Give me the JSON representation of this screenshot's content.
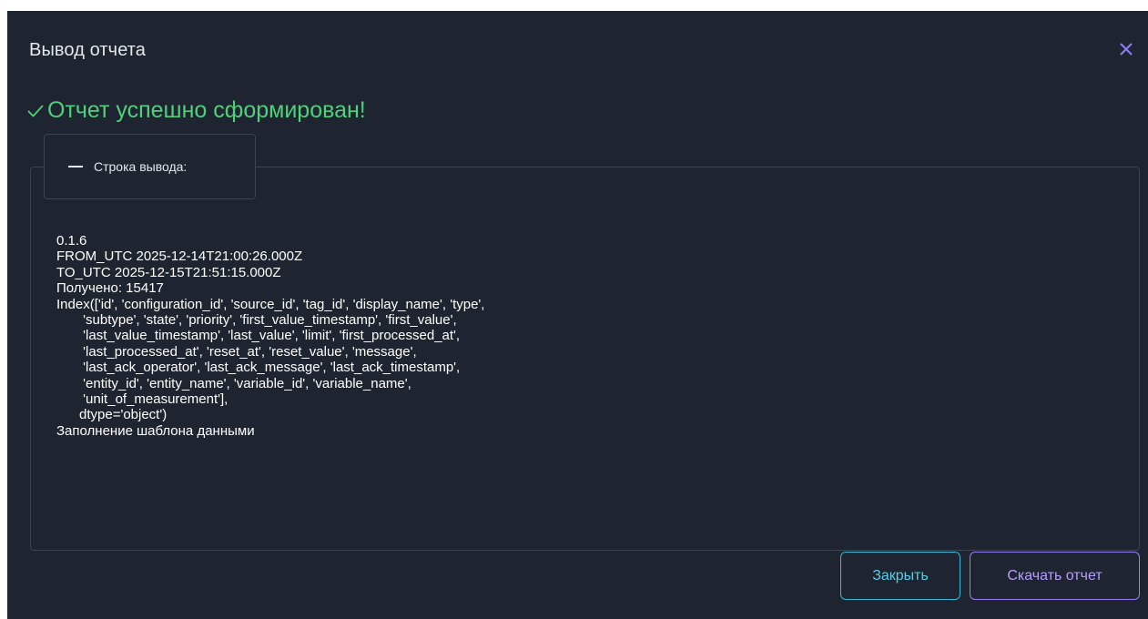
{
  "dialog": {
    "title": "Вывод отчета",
    "close_icon": "close-icon"
  },
  "status": {
    "icon": "check-icon",
    "message": "Отчет успешно сформирован!",
    "color": "#4fd07a"
  },
  "output_section": {
    "toggle_icon": "collapse-dash-icon",
    "label": "Строка вывода:",
    "lines": [
      "0.1.6",
      "FROM_UTC 2025-12-14T21:00:26.000Z",
      "TO_UTC 2025-12-15T21:51:15.000Z",
      "Получено: 15417",
      "Index(['id', 'configuration_id', 'source_id', 'tag_id', 'display_name', 'type',",
      "       'subtype', 'state', 'priority', 'first_value_timestamp', 'first_value',",
      "       'last_value_timestamp', 'last_value', 'limit', 'first_processed_at',",
      "       'last_processed_at', 'reset_at', 'reset_value', 'message',",
      "       'last_ack_operator', 'last_ack_message', 'last_ack_timestamp',",
      "       'entity_id', 'entity_name', 'variable_id', 'variable_name',",
      "       'unit_of_measurement'],",
      "      dtype='object')",
      "Заполнение шаблона данными"
    ]
  },
  "buttons": {
    "close_label": "Закрыть",
    "download_label": "Скачать отчет"
  },
  "colors": {
    "background": "#1f2530",
    "close_accent": "#33b8d6",
    "download_accent": "#9b7bf0",
    "close_icon": "#8f7cf5"
  }
}
